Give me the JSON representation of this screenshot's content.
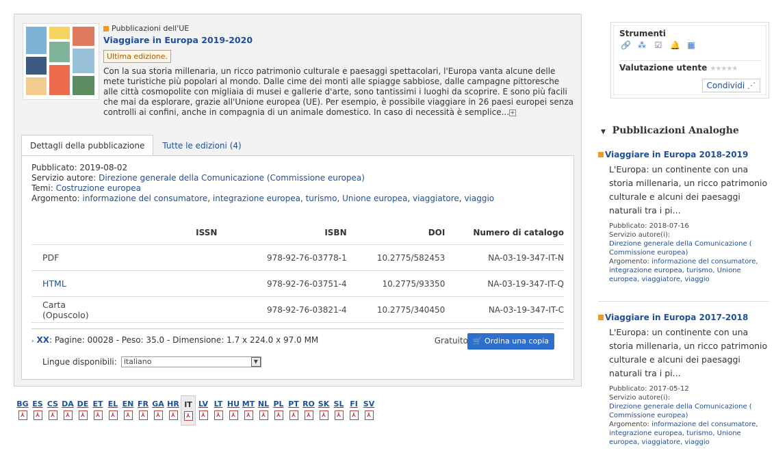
{
  "publication": {
    "category": "Pubblicazioni dell'UE",
    "title": "Viaggiare in Europa 2019-2020",
    "badge": "Ultima edizione.",
    "description": "Con la sua storia millenaria, un ricco patrimonio culturale e paesaggi spettacolari, l'Europa vanta alcune delle mete turistiche più popolari al mondo. Dalle cime dei monti alle spiagge sabbiose, dalle campagne pittoresche alle città cosmopolite con migliaia di musei e gallerie d'arte, sono tantissimi i luoghi da scoprire. E sono più facili che mai da esplorare, grazie all'Unione europea (UE). Per esempio, è possibile viaggiare in 26 paesi europei senza controlli ai confini, anche in compagnia di un animale domestico. In caso di necessità è semplice..."
  },
  "tabs": [
    "Dettagli della pubblicazione",
    "Tutte le edizioni (4)"
  ],
  "details": {
    "published_label": "Pubblicato:",
    "published": "2019-08-02",
    "author_label": "Servizio autore:",
    "author": "Direzione generale della Comunicazione (Commissione europea)",
    "themes_label": "Temi:",
    "themes": "Costruzione europea",
    "subject_label": "Argomento:",
    "subjects": [
      "informazione del consumatore",
      "integrazione europea",
      "turismo",
      "Unione europea",
      "viaggiatore",
      "viaggio"
    ]
  },
  "table": {
    "headers": [
      "ISSN",
      "ISBN",
      "DOI",
      "Numero di catalogo"
    ],
    "rows": [
      {
        "format": "PDF",
        "issn": "",
        "isbn": "978-92-76-03778-1",
        "doi": "10.2775/582453",
        "catalog": "NA-03-19-347-IT-N"
      },
      {
        "format": "HTML",
        "issn": "",
        "isbn": "978-92-76-03751-4",
        "doi": "10.2775/93350",
        "catalog": "NA-03-19-347-IT-Q"
      },
      {
        "format": "Carta (Opuscolo)",
        "issn": "",
        "isbn": "978-92-76-03821-4",
        "doi": "10.2775/340450",
        "catalog": "NA-03-19-347-IT-C"
      }
    ]
  },
  "print": {
    "code": "XX",
    "info": "Pagine: 00028 - Peso: 35.0 - Dimensione: 1.7 x 224.0 x 97.0 MM",
    "languages_label": "Lingue disponibili:",
    "language_selected": "italiano",
    "price": "Gratuito",
    "order_label": "Ordina una copia"
  },
  "languages": [
    "BG",
    "ES",
    "CS",
    "DA",
    "DE",
    "ET",
    "EL",
    "EN",
    "FR",
    "GA",
    "HR",
    "IT",
    "LV",
    "LT",
    "HU",
    "MT",
    "NL",
    "PL",
    "PT",
    "RO",
    "SK",
    "SL",
    "FI",
    "SV"
  ],
  "selected_language": "IT",
  "tools": {
    "title": "Strumenti",
    "icons": [
      "link-icon",
      "share-network-icon",
      "checklist-icon",
      "bell-icon",
      "grid-icon"
    ],
    "rating_label": "Valutazione utente",
    "stars": "★★★★★",
    "share_label": "Condividi"
  },
  "similar": {
    "heading": "Pubblicazioni Analoghe",
    "items": [
      {
        "title": "Viaggiare in Europa 2018-2019",
        "desc": "L'Europa: un continente con una storia millenaria, un ricco patrimonio culturale e alcuni dei paesaggi naturali tra i pi...",
        "published": "Pubblicato: 2018-07-16",
        "author_label": "Servizio autore(i):",
        "author": "Direzione generale della Comunicazione ( Commissione europea)",
        "subject_label": "Argomento:",
        "subjects": "informazione del consumatore, integrazione europea, turismo, Unione europea, viaggiatore, viaggio"
      },
      {
        "title": "Viaggiare in Europa 2017-2018",
        "desc": "L'Europa: un continente con una storia millenaria, un ricco patrimonio culturale e alcuni dei paesaggi naturali tra i pi...",
        "published": "Pubblicato: 2017-05-12",
        "author_label": "Servizio autore(i):",
        "author": "Direzione generale della Comunicazione ( Commissione europea)",
        "subject_label": "Argomento:",
        "subjects": "informazione del consumatore, integrazione europea, turismo, Unione europea, viaggiatore, viaggio"
      }
    ]
  }
}
